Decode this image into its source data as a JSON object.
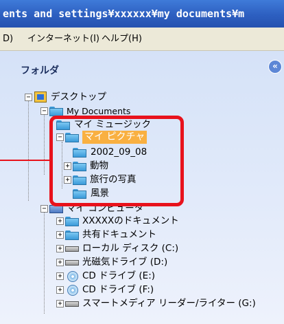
{
  "window": {
    "title": "ents and settings¥xxxxxx¥my documents¥m"
  },
  "menubar": {
    "items": [
      "D)",
      "インターネット(I)",
      "ヘルプ(H)"
    ]
  },
  "pane": {
    "title": "フォルダ",
    "collapse_icon": "double-chevron-left-icon"
  },
  "tree": {
    "desktop": "デスクトップ",
    "my_documents": "My Documents",
    "my_music": "マイ ミュージック",
    "my_pictures": "マイ ピクチャ",
    "folders": [
      "2002_09_08",
      "動物",
      "旅行の写真",
      "風景"
    ],
    "my_computer": "マイ コンピュータ",
    "computer_items": [
      "XXXXXのドキュメント",
      "共有ドキュメント",
      "ローカル ディスク (C:)",
      "光磁気ドライブ (D:)",
      "CD ドライブ (E:)",
      "CD ドライブ (F:)",
      "スマートメディア リーダー/ライター (G:)"
    ]
  },
  "highlight": {
    "color": "#e8121c",
    "selection_color": "#f9b041"
  }
}
